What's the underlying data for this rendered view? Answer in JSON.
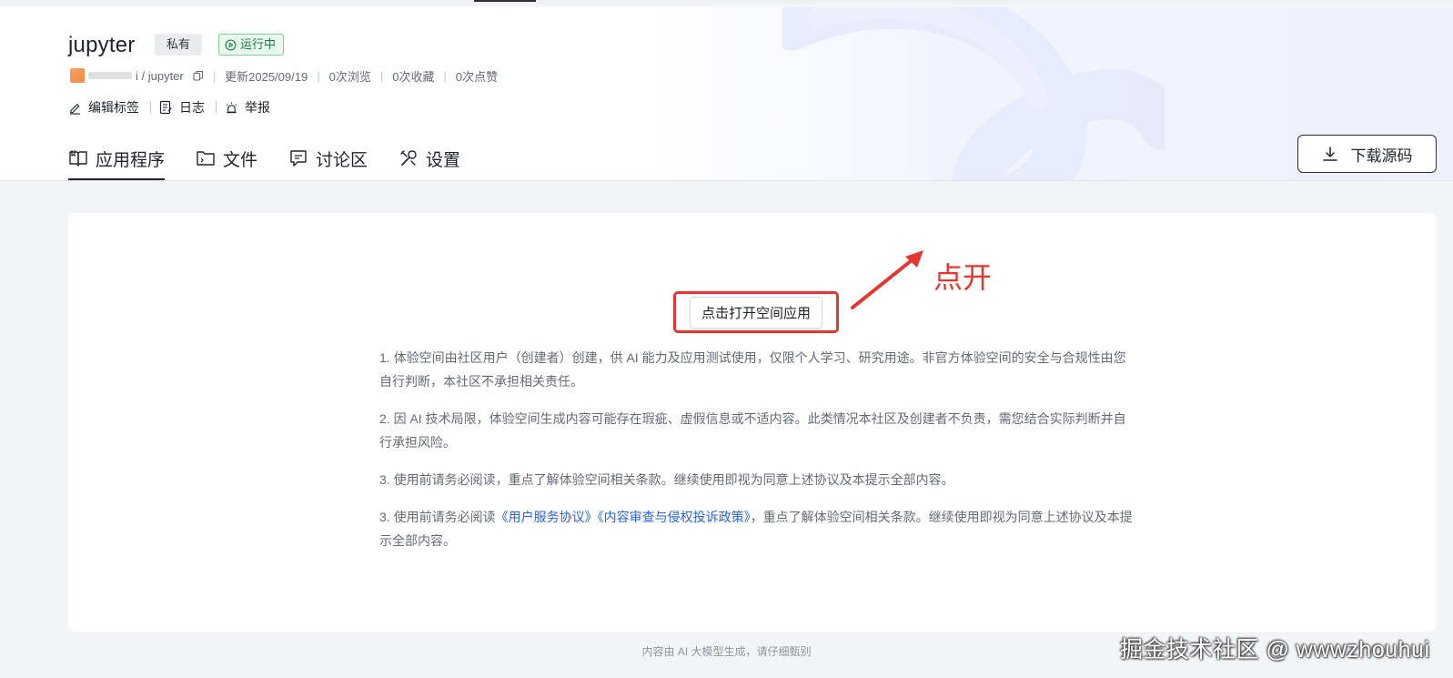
{
  "header": {
    "title": "jupyter",
    "badge_private": "私有",
    "badge_running": "运行中",
    "meta": {
      "path": "i / jupyter",
      "updated": "更新2025/09/19",
      "views": "0次浏览",
      "favorites": "0次收藏",
      "likes": "0次点赞"
    },
    "actions": {
      "edit_tags": "编辑标签",
      "log": "日志",
      "report": "举报"
    }
  },
  "tabs": [
    {
      "label": "应用程序",
      "active": true
    },
    {
      "label": "文件"
    },
    {
      "label": "讨论区"
    },
    {
      "label": "设置"
    }
  ],
  "download_label": "下载源码",
  "main": {
    "open_button": "点击打开空间应用",
    "annotation": "点开",
    "notes": {
      "n1": "1. 体验空间由社区用户（创建者）创建，供 AI 能力及应用测试使用，仅限个人学习、研究用途。非官方体验空间的安全与合规性由您自行判断，本社区不承担相关责任。",
      "n2": "2. 因 AI 技术局限，体验空间生成内容可能存在瑕疵、虚假信息或不适内容。此类情况本社区及创建者不负责，需您结合实际判断并自行承担风险。",
      "n3": "3. 使用前请务必阅读，重点了解体验空间相关条款。继续使用即视为同意上述协议及本提示全部内容。",
      "n4_prefix": "3. 使用前请务必阅读",
      "n4_link1": "《用户服务协议》",
      "n4_link2": "《内容审查与侵权投诉政策》",
      "n4_suffix": "，重点了解体验空间相关条款。继续使用即视为同意上述协议及本提示全部内容。"
    }
  },
  "footer": "内容由 AI 大模型生成，请仔细甄别",
  "watermark": "掘金技术社区 @ wwwzhouhui",
  "colors": {
    "accent_red": "#e5352f",
    "link_blue": "#2a63d6",
    "running_green": "#1e7a43"
  }
}
